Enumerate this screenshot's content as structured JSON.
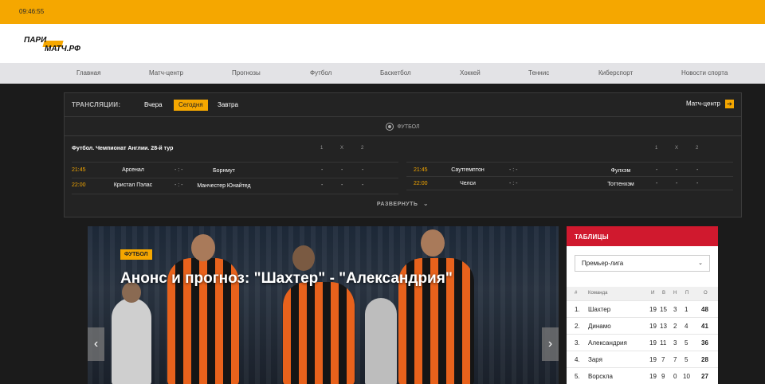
{
  "topbar": {
    "time": "09:46:55"
  },
  "header": {
    "logo_line1": "ПАРИ",
    "logo_line2": "МАТЧ.РФ"
  },
  "nav": [
    "Главная",
    "Матч-центр",
    "Прогнозы",
    "Футбол",
    "Баскетбол",
    "Хоккей",
    "Теннис",
    "Киберспорт",
    "Новости спорта"
  ],
  "broadcast": {
    "title": "ТРАНСЛЯЦИИ:",
    "tabs": [
      "Вчера",
      "Сегодня",
      "Завтра"
    ],
    "active_tab": "Сегодня",
    "match_center": "Матч-центр",
    "sport": "ФУТБОЛ",
    "league": "Футбол. Чемпионат Англии. 28-й тур",
    "odds_headers": [
      "1",
      "X",
      "2"
    ],
    "matches_left": [
      {
        "time": "21:45",
        "home": "Арсенал",
        "score": "- : -",
        "away": "Борнмут",
        "o1": "-",
        "ox": "-",
        "o2": "-"
      },
      {
        "time": "22:00",
        "home": "Кристал Пэлас",
        "score": "- : -",
        "away": "Манчестер Юнайтед",
        "o1": "-",
        "ox": "-",
        "o2": "-"
      }
    ],
    "matches_right": [
      {
        "time": "21:45",
        "home": "Саутгемптон",
        "score": "- : -",
        "away": "Фулхэм",
        "o1": "-",
        "ox": "-",
        "o2": "-"
      },
      {
        "time": "22:00",
        "home": "Челси",
        "score": "- : -",
        "away": "Тоттенхэм",
        "o1": "-",
        "ox": "-",
        "o2": "-"
      }
    ],
    "expand": "РАЗВЕРНУТЬ"
  },
  "hero": {
    "badge": "ФУТБОЛ",
    "title": "Анонс и прогноз: \"Шахтер\" - \"Александрия\""
  },
  "tables": {
    "title": "ТАБЛИЦЫ",
    "league_select": "Премьер-лига",
    "headers": {
      "num": "#",
      "team": "Команда",
      "g": "И",
      "w": "В",
      "d": "Н",
      "l": "П",
      "pts": "О"
    },
    "rows": [
      {
        "num": "1.",
        "team": "Шахтер",
        "g": "19",
        "w": "15",
        "d": "3",
        "l": "1",
        "pts": "48"
      },
      {
        "num": "2.",
        "team": "Динамо",
        "g": "19",
        "w": "13",
        "d": "2",
        "l": "4",
        "pts": "41"
      },
      {
        "num": "3.",
        "team": "Александрия",
        "g": "19",
        "w": "11",
        "d": "3",
        "l": "5",
        "pts": "36"
      },
      {
        "num": "4.",
        "team": "Заря",
        "g": "19",
        "w": "7",
        "d": "7",
        "l": "5",
        "pts": "28"
      },
      {
        "num": "5.",
        "team": "Ворскла",
        "g": "19",
        "w": "9",
        "d": "0",
        "l": "10",
        "pts": "27"
      }
    ]
  },
  "colors": {
    "accent": "#f5a700",
    "tables_header": "#d0192e",
    "background": "#1b1b1b"
  }
}
